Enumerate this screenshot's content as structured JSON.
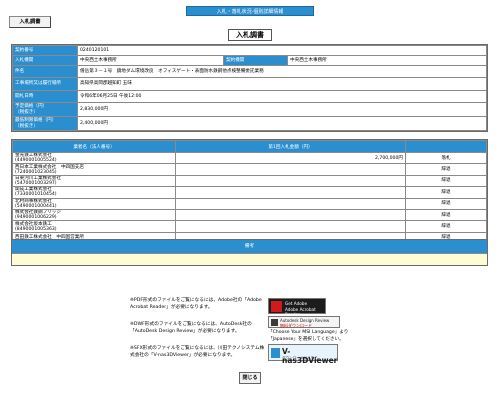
{
  "header": {
    "breadcrumb": "入札・落札状況-個別詳細情報",
    "tab_label": "入札調書",
    "page_title": "入札調書"
  },
  "info": {
    "contract_no_label": "契約番号",
    "contract_no": "0240120101",
    "org_label": "入札機関",
    "org": "中央西土木事務所",
    "contract_org_label": "契約機関",
    "contract_org": "中央西土木事務所",
    "case_label": "件名",
    "case_name": "僧岳第３－１号　鏡地ダム環境改良　オフィスゲート・表面防水鉄鋼他点検整備委託業務",
    "place_label": "工事場所又は履行場所",
    "place": "高知県高岡郡越知町 五味",
    "date_label": "開札日時",
    "date": "令和6年06月25日 午後12:00",
    "planned_price_label": "予定価格（円）\n（税抜き）",
    "planned_price": "2,830,000円",
    "min_price_label": "最低制限価格（円）\n（税抜き）",
    "min_price": "2,400,000円"
  },
  "results": {
    "col_company": "業者名（法人番号）",
    "col_amount": "第1回入札金額（円）",
    "rows": [
      {
        "name": "金光鉄工株式会社",
        "num": "(4490001005524)",
        "amount": "2,700,000円",
        "status": "落札"
      },
      {
        "name": "西日本工業株式会社　中四国支店",
        "num": "(7240001023045)",
        "amount": "",
        "status": "辞退"
      },
      {
        "name": "日東河川工業株式会社",
        "num": "(5470001003297)",
        "amount": "",
        "status": "辞退"
      },
      {
        "name": "関成工業株式会社",
        "num": "(7330001010454)",
        "amount": "",
        "status": "辞退"
      },
      {
        "name": "北村商事株式会社",
        "num": "(5490001000441)",
        "amount": "",
        "status": "辞退"
      },
      {
        "name": "株式会社鉄鋼ブリッジ",
        "num": "(9490001006229)",
        "amount": "",
        "status": "辞退"
      },
      {
        "name": "株式会社坂本鉄工",
        "num": "(8490001005363)",
        "amount": "",
        "status": "辞退"
      },
      {
        "name": "西田鉄工株式会社　中四国営業所",
        "num": "",
        "amount": "",
        "status": "辞退"
      }
    ]
  },
  "remarks": {
    "label": "備考",
    "text": ""
  },
  "notes": {
    "pdf": "※PDF形式のファイルをご覧になるには、Adobe社の「Adobe Acrobat Reader」が必要になります。",
    "dwf": "※DWF形式のファイルをご覧になるには、AutoDesk社の「AutoDesk Design Review」が必要になります。",
    "sfx": "※SFX形式のファイルをご覧になるには、川田テクノシステム株式会社の「V-nas3DViewer」が必要になります。",
    "adobe_banner": "Adobe Acrobat Reader",
    "adobe_banner_top": "Get Adobe",
    "autodesk_banner_top": "Autodesk Design Review",
    "autodesk_banner_sub": "無料ダウンロード",
    "autodesk_help_1": "「Choose Your MSI Language」より",
    "autodesk_help_2": "「Japanese」を選択してください。",
    "vnas_banner": "V-nas3DViewer",
    "vnas_small": "ダウンロードはこちら"
  },
  "footer": {
    "close_label": "閉じる"
  },
  "colors": {
    "header_blue": "#2b8ecf",
    "remarks_bg": "#fffbd5"
  }
}
